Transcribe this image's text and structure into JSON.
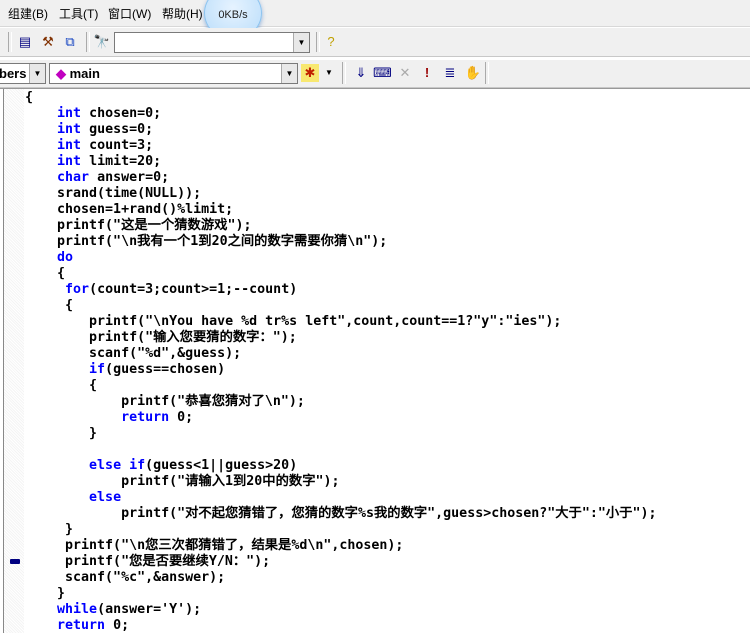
{
  "menu": [
    "组建(B)",
    "工具(T)",
    "窗口(W)",
    "帮助(H)"
  ],
  "net_speed": "0KB/s",
  "toolbar": {
    "find_combo_value": "",
    "class_combo_value": "bers",
    "function_combo_value": "main"
  },
  "code": [
    [
      [
        "{",
        0
      ]
    ],
    [
      [
        "    ",
        0
      ],
      [
        "int",
        1
      ],
      [
        " chosen=0;",
        0
      ]
    ],
    [
      [
        "    ",
        0
      ],
      [
        "int",
        1
      ],
      [
        " guess=0;",
        0
      ]
    ],
    [
      [
        "    ",
        0
      ],
      [
        "int",
        1
      ],
      [
        " count=3;",
        0
      ]
    ],
    [
      [
        "    ",
        0
      ],
      [
        "int",
        1
      ],
      [
        " limit=20;",
        0
      ]
    ],
    [
      [
        "    ",
        0
      ],
      [
        "char",
        1
      ],
      [
        " answer=0;",
        0
      ]
    ],
    [
      [
        "    srand(time(NULL));",
        0
      ]
    ],
    [
      [
        "    chosen=1+rand()%limit;",
        0
      ]
    ],
    [
      [
        "    printf(\"这是一个猜数游戏\");",
        0
      ]
    ],
    [
      [
        "    printf(\"\\n我有一个1到20之间的数字需要你猜\\n\");",
        0
      ]
    ],
    [
      [
        "    ",
        0
      ],
      [
        "do",
        1
      ]
    ],
    [
      [
        "    {",
        0
      ]
    ],
    [
      [
        "     ",
        0
      ],
      [
        "for",
        1
      ],
      [
        "(count=3;count>=1;--count)",
        0
      ]
    ],
    [
      [
        "     {",
        0
      ]
    ],
    [
      [
        "        printf(\"\\nYou have %d tr%s left\",count,count==1?\"y\":\"ies\");",
        0
      ]
    ],
    [
      [
        "        printf(\"输入您要猜的数字：\");",
        0
      ]
    ],
    [
      [
        "        scanf(\"%d\",&guess);",
        0
      ]
    ],
    [
      [
        "        ",
        0
      ],
      [
        "if",
        1
      ],
      [
        "(guess==chosen)",
        0
      ]
    ],
    [
      [
        "        {",
        0
      ]
    ],
    [
      [
        "            printf(\"恭喜您猜对了\\n\");",
        0
      ]
    ],
    [
      [
        "            ",
        0
      ],
      [
        "return",
        1
      ],
      [
        " 0;",
        0
      ]
    ],
    [
      [
        "        }",
        0
      ]
    ],
    [
      [
        "",
        0
      ]
    ],
    [
      [
        "        ",
        0
      ],
      [
        "else if",
        1
      ],
      [
        "(guess<1||guess>20)",
        0
      ]
    ],
    [
      [
        "            printf(\"请输入1到20中的数字\");",
        0
      ]
    ],
    [
      [
        "        ",
        0
      ],
      [
        "else",
        1
      ]
    ],
    [
      [
        "            printf(\"对不起您猜错了，您猜的数字%s我的数字\",guess>chosen?\"大于\":\"小于\");",
        0
      ]
    ],
    [
      [
        "     }",
        0
      ]
    ],
    [
      [
        "     printf(\"\\n您三次都猜错了，结果是%d\\n\",chosen);",
        0
      ]
    ],
    [
      [
        "     printf(\"您是否要继续Y/N：\");",
        0
      ]
    ],
    [
      [
        "     scanf(\"%c\",&answer);",
        0
      ]
    ],
    [
      [
        "    }",
        0
      ]
    ],
    [
      [
        "    ",
        0
      ],
      [
        "while",
        1
      ],
      [
        "(answer='Y');",
        0
      ]
    ],
    [
      [
        "    ",
        0
      ],
      [
        "return",
        1
      ],
      [
        " 0;",
        0
      ]
    ]
  ]
}
